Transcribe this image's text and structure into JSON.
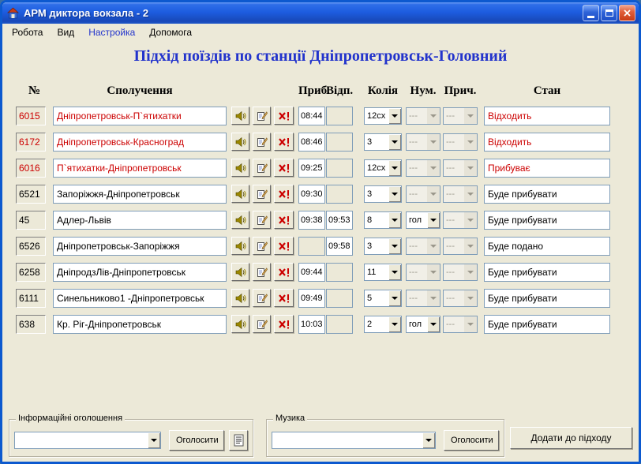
{
  "window": {
    "title": "АРМ диктора вокзала - 2"
  },
  "menu": {
    "items": [
      {
        "label": "Робота"
      },
      {
        "label": "Вид"
      },
      {
        "label": "Настройка"
      },
      {
        "label": "Допомога"
      }
    ]
  },
  "heading": "Підхід поїздів по станції Дніпропетровськ-Головний",
  "table": {
    "headers": {
      "id": "№",
      "route": "Сполучення",
      "arrive": "Приб.",
      "depart": "Відп.",
      "track": "Колія",
      "numeration": "Нум.",
      "reason": "Прич.",
      "status": "Стан"
    },
    "rows": [
      {
        "id": "6015",
        "accent": true,
        "route": "Дніпропетровськ-П`ятихатки",
        "arrive": "08:44",
        "depart": "",
        "track": "12сх",
        "numeration": {
          "value": "---",
          "enabled": false
        },
        "reason": {
          "value": "---",
          "enabled": false
        },
        "status": "Відходить",
        "status_accent": true
      },
      {
        "id": "6172",
        "accent": true,
        "route": "Дніпропетровськ-Красноград",
        "arrive": "08:46",
        "depart": "",
        "track": "3",
        "numeration": {
          "value": "---",
          "enabled": false
        },
        "reason": {
          "value": "---",
          "enabled": false
        },
        "status": "Відходить",
        "status_accent": true
      },
      {
        "id": "6016",
        "accent": true,
        "route": "П`ятихатки-Дніпропетровськ",
        "arrive": "09:25",
        "depart": "",
        "track": "12сх",
        "numeration": {
          "value": "---",
          "enabled": false
        },
        "reason": {
          "value": "---",
          "enabled": false
        },
        "status": "Прибуває",
        "status_accent": true
      },
      {
        "id": "6521",
        "accent": false,
        "route": "Запоріжжя-Дніпропетровськ",
        "arrive": "09:30",
        "depart": "",
        "track": "3",
        "numeration": {
          "value": "---",
          "enabled": false
        },
        "reason": {
          "value": "---",
          "enabled": false
        },
        "status": "Буде прибувати",
        "status_accent": false
      },
      {
        "id": "45",
        "accent": false,
        "route": "Адлер-Львів",
        "arrive": "09:38",
        "depart": "09:53",
        "track": "8",
        "numeration": {
          "value": "гол",
          "enabled": true
        },
        "reason": {
          "value": "---",
          "enabled": false
        },
        "status": "Буде прибувати",
        "status_accent": false
      },
      {
        "id": "6526",
        "accent": false,
        "route": "Дніпропетровськ-Запоріжжя",
        "arrive": "",
        "depart": "09:58",
        "track": "3",
        "numeration": {
          "value": "---",
          "enabled": false
        },
        "reason": {
          "value": "---",
          "enabled": false
        },
        "status": "Буде подано",
        "status_accent": false
      },
      {
        "id": "6258",
        "accent": false,
        "route": "ДніпродзЛів-Дніпропетровськ",
        "arrive": "09:44",
        "depart": "",
        "track": "11",
        "numeration": {
          "value": "---",
          "enabled": false
        },
        "reason": {
          "value": "---",
          "enabled": false
        },
        "status": "Буде прибувати",
        "status_accent": false
      },
      {
        "id": "6111",
        "accent": false,
        "route": "Синельниково1 -Дніпропетровськ",
        "arrive": "09:49",
        "depart": "",
        "track": "5",
        "numeration": {
          "value": "---",
          "enabled": false
        },
        "reason": {
          "value": "---",
          "enabled": false
        },
        "status": "Буде прибувати",
        "status_accent": false
      },
      {
        "id": "638",
        "accent": false,
        "route": "Кр. Ріг-Дніпропетровськ",
        "arrive": "10:03",
        "depart": "",
        "track": "2",
        "numeration": {
          "value": "гол",
          "enabled": true
        },
        "reason": {
          "value": "---",
          "enabled": false
        },
        "status": "Буде прибувати",
        "status_accent": false
      }
    ]
  },
  "footer": {
    "announcements": {
      "title": "Інформаційні оголошення",
      "announce_label": "Оголосити"
    },
    "music": {
      "title": "Музика",
      "announce_label": "Оголосити"
    },
    "add_button": "Додати до підходу"
  },
  "colors": {
    "accent_red": "#CC0000",
    "heading_blue": "#2233CC",
    "titlebar_blue": "#1D5DE0",
    "window_bg": "#ECE9D8"
  }
}
